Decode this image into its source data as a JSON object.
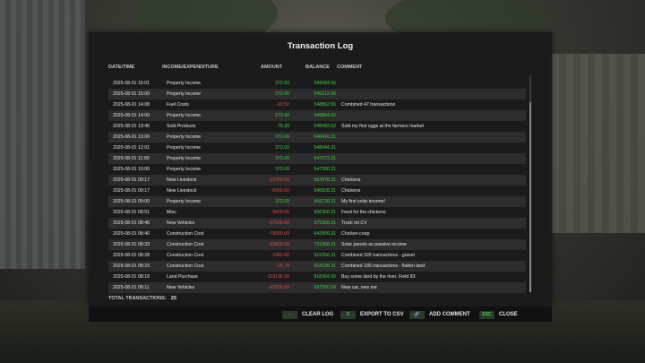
{
  "dialog": {
    "title": "Transaction Log",
    "columns": {
      "date": "DATE/TIME",
      "type": "INCOME/EXPENDITURE",
      "amount": "AMOUNT",
      "balance": "BALANCE",
      "comment": "COMMENT"
    },
    "rows": [
      {
        "date": "2025-08-01 16:01",
        "type": "Property Income",
        "amount": "372.00",
        "balance": "549584.56",
        "comment": "",
        "sign": "pos"
      },
      {
        "date": "2025-08-01 15:00",
        "type": "Property Income",
        "amount": "372.00",
        "balance": "549212.56",
        "comment": "",
        "sign": "pos"
      },
      {
        "date": "2025-08-01 14:08",
        "type": "Fuel Costs",
        "amount": "-22.50",
        "balance": "548862.56",
        "comment": "Combined 47 transactions",
        "sign": "neg"
      },
      {
        "date": "2025-08-01 14:00",
        "type": "Property Income",
        "amount": "372.00",
        "balance": "548864.62",
        "comment": "",
        "sign": "pos"
      },
      {
        "date": "2025-08-01 13:46",
        "type": "Sold Products",
        "amount": "76.28",
        "balance": "548492.62",
        "comment": "Sold my first eggs at the farmers market",
        "sign": "pos"
      },
      {
        "date": "2025-08-01 13:00",
        "type": "Property Income",
        "amount": "372.00",
        "balance": "548416.31",
        "comment": "",
        "sign": "pos"
      },
      {
        "date": "2025-08-01 12:01",
        "type": "Property Income",
        "amount": "372.00",
        "balance": "548044.31",
        "comment": "",
        "sign": "pos"
      },
      {
        "date": "2025-08-01 11:00",
        "type": "Property Income",
        "amount": "372.00",
        "balance": "547672.31",
        "comment": "",
        "sign": "pos"
      },
      {
        "date": "2025-08-01 10:00",
        "type": "Property Income",
        "amount": "372.00",
        "balance": "547300.31",
        "comment": "",
        "sign": "pos"
      },
      {
        "date": "2025-08-01 09:17",
        "type": "New Livestock",
        "amount": "-13750.00",
        "balance": "552978.31",
        "comment": "Chickens",
        "sign": "neg"
      },
      {
        "date": "2025-08-01 09:17",
        "type": "New Livestock",
        "amount": "-6050.00",
        "balance": "546928.31",
        "comment": "Chickens",
        "sign": "neg"
      },
      {
        "date": "2025-08-01 09:00",
        "type": "Property Income",
        "amount": "372.00",
        "balance": "566728.31",
        "comment": "My first solar income!",
        "sign": "pos"
      },
      {
        "date": "2025-08-01 08:51",
        "type": "Misc",
        "amount": "-9000.00",
        "balance": "566356.31",
        "comment": "Feed for the chickens",
        "sign": "neg"
      },
      {
        "date": "2025-08-01 08:45",
        "type": "New Vehicles",
        "amount": "-67500.00",
        "balance": "575356.31",
        "comment": "Truck Int CV",
        "sign": "neg"
      },
      {
        "date": "2025-08-01 08:40",
        "type": "Construction Cost",
        "amount": "-79000.00",
        "balance": "642856.31",
        "comment": "Chicken coop",
        "sign": "neg"
      },
      {
        "date": "2025-08-01 08:33",
        "type": "Construction Cost",
        "amount": "-93500.00",
        "balance": "721858.31",
        "comment": "Solar panels as passive income",
        "sign": "neg"
      },
      {
        "date": "2025-08-01 08:28",
        "type": "Construction Cost",
        "amount": "-2982.00",
        "balance": "815356.31",
        "comment": "Combined 326 transactions - gravel",
        "sign": "neg"
      },
      {
        "date": "2025-08-01 08:23",
        "type": "Construction Cost",
        "amount": "-25.70",
        "balance": "818338.31",
        "comment": "Combined 235 transactions - flatten land",
        "sign": "neg"
      },
      {
        "date": "2025-08-01 08:18",
        "type": "Land Purchase",
        "amount": "-119136.00",
        "balance": "818364.00",
        "comment": "Buy some land by the river. Field 83",
        "sign": "neg"
      },
      {
        "date": "2025-08-01 08:11",
        "type": "New Vehicles",
        "amount": "-62500.00",
        "balance": "937500.00",
        "comment": "New car, new me",
        "sign": "neg"
      }
    ],
    "total_label": "TOTAL TRANSACTIONS:",
    "total_count": "25",
    "scroll_position": 0.1
  },
  "footer": {
    "clear": {
      "key": "⇔",
      "label": "CLEAR LOG"
    },
    "export": {
      "key": "X",
      "label": "EXPORT TO CSV"
    },
    "add": {
      "key": "🔗",
      "label": "ADD COMMENT"
    },
    "close": {
      "key": "ESC",
      "label": "CLOSE"
    }
  },
  "colors": {
    "positive": "#39d33f",
    "negative": "#e04b4b",
    "balance": "#39d33f"
  }
}
